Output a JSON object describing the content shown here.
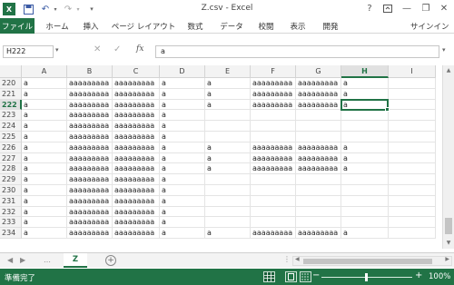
{
  "window": {
    "title": "Z.csv - Excel",
    "help": "?",
    "minimize": "—",
    "restore": "❐",
    "close": "✕"
  },
  "quick_access": {
    "save_icon": "save-icon",
    "undo": "↶",
    "redo": "↷",
    "customize": "▾"
  },
  "ribbon": {
    "tabs": [
      "ファイル",
      "ホーム",
      "挿入",
      "ページ レイアウト",
      "数式",
      "データ",
      "校閲",
      "表示",
      "開発"
    ],
    "signin": "サインイン"
  },
  "formula_bar": {
    "name_box": "H222",
    "cancel": "✕",
    "enter": "✓",
    "fx": "fx",
    "formula": "a"
  },
  "grid": {
    "columns": [
      "A",
      "B",
      "C",
      "D",
      "E",
      "F",
      "G",
      "H",
      "I"
    ],
    "selected_column": "H",
    "selected_row": "222",
    "rows": [
      {
        "num": "220",
        "cells": [
          "a",
          "aaaaaaaaa",
          "aaaaaaaaa",
          "a",
          "a",
          "aaaaaaaaa",
          "aaaaaaaaa",
          "a",
          ""
        ]
      },
      {
        "num": "221",
        "cells": [
          "a",
          "aaaaaaaaa",
          "aaaaaaaaa",
          "a",
          "a",
          "aaaaaaaaa",
          "aaaaaaaaa",
          "a",
          ""
        ]
      },
      {
        "num": "222",
        "cells": [
          "a",
          "aaaaaaaaa",
          "aaaaaaaaa",
          "a",
          "a",
          "aaaaaaaaa",
          "aaaaaaaaa",
          "a",
          ""
        ]
      },
      {
        "num": "223",
        "cells": [
          "a",
          "aaaaaaaaa",
          "aaaaaaaaa",
          "a",
          "",
          "",
          "",
          "",
          ""
        ]
      },
      {
        "num": "224",
        "cells": [
          "a",
          "aaaaaaaaa",
          "aaaaaaaaa",
          "a",
          "",
          "",
          "",
          "",
          ""
        ]
      },
      {
        "num": "225",
        "cells": [
          "a",
          "aaaaaaaaa",
          "aaaaaaaaa",
          "a",
          "",
          "",
          "",
          "",
          ""
        ]
      },
      {
        "num": "226",
        "cells": [
          "a",
          "aaaaaaaaa",
          "aaaaaaaaa",
          "a",
          "a",
          "aaaaaaaaa",
          "aaaaaaaaa",
          "a",
          ""
        ]
      },
      {
        "num": "227",
        "cells": [
          "a",
          "aaaaaaaaa",
          "aaaaaaaaa",
          "a",
          "a",
          "aaaaaaaaa",
          "aaaaaaaaa",
          "a",
          ""
        ]
      },
      {
        "num": "228",
        "cells": [
          "a",
          "aaaaaaaaa",
          "aaaaaaaaa",
          "a",
          "a",
          "aaaaaaaaa",
          "aaaaaaaaa",
          "a",
          ""
        ]
      },
      {
        "num": "229",
        "cells": [
          "a",
          "aaaaaaaaa",
          "aaaaaaaaa",
          "a",
          "",
          "",
          "",
          "",
          ""
        ]
      },
      {
        "num": "230",
        "cells": [
          "a",
          "aaaaaaaaa",
          "aaaaaaaaa",
          "a",
          "",
          "",
          "",
          "",
          ""
        ]
      },
      {
        "num": "231",
        "cells": [
          "a",
          "aaaaaaaaa",
          "aaaaaaaaa",
          "a",
          "",
          "",
          "",
          "",
          ""
        ]
      },
      {
        "num": "232",
        "cells": [
          "a",
          "aaaaaaaaa",
          "aaaaaaaaa",
          "a",
          "",
          "",
          "",
          "",
          ""
        ]
      },
      {
        "num": "233",
        "cells": [
          "a",
          "aaaaaaaaa",
          "aaaaaaaaa",
          "a",
          "",
          "",
          "",
          "",
          ""
        ]
      },
      {
        "num": "234",
        "cells": [
          "a",
          "aaaaaaaaa",
          "aaaaaaaaa",
          "a",
          "a",
          "aaaaaaaaa",
          "aaaaaaaaa",
          "a",
          ""
        ]
      }
    ]
  },
  "sheet_tabs": {
    "nav_prev": "◀",
    "nav_next": "▶",
    "more": "…",
    "tabs": [
      "Z"
    ],
    "add": "+"
  },
  "status_bar": {
    "status": "準備完了",
    "zoom_minus": "−",
    "zoom_plus": "+",
    "zoom_level": "100%",
    "zoom_percent": 100
  },
  "colors": {
    "accent": "#217346",
    "accent_dark": "#1a5e39",
    "header_bg": "#f3f3f3"
  }
}
